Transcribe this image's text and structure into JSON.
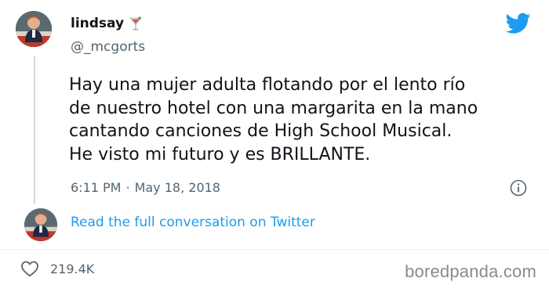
{
  "tweet": {
    "display_name": "lindsay",
    "name_emoji": "martini-emoji",
    "handle": "@_mcgorts",
    "text": "Hay una mujer adulta flotando por el lento río\nde nuestro hotel con una margarita en la mano\ncantando canciones de High School Musical.\nHe visto mi futuro y es BRILLANTE.",
    "time": "6:11 PM",
    "separator": "·",
    "date": "May 18, 2018",
    "read_more": "Read the full conversation on Twitter",
    "likes": "219.4K"
  },
  "icons": {
    "logo": "twitter-bird-icon",
    "info": "info-icon",
    "like": "heart-icon"
  },
  "colors": {
    "accent": "#1d9bf0",
    "text": "#0f1419",
    "muted": "#536471"
  },
  "watermark": "boredpanda.com"
}
